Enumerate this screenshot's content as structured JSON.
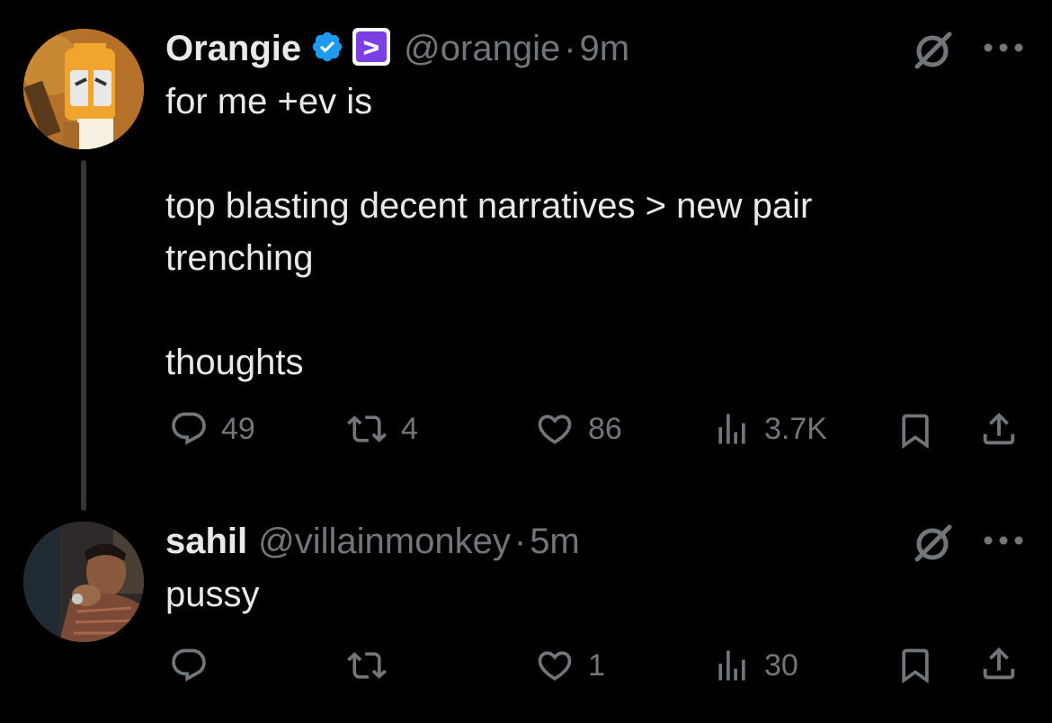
{
  "tweets": [
    {
      "name": "Orangie",
      "handle": "@orangie",
      "separator": "·",
      "time": "9m",
      "body": "for me +ev is\n\ntop blasting decent narratives > new pair\ntrenching\n\nthoughts",
      "replies": "49",
      "reposts": "4",
      "likes": "86",
      "views": "3.7K",
      "icons": {
        "verified": "verified-badge-icon",
        "affiliate": "affiliate-badge-icon",
        "grok": "grok-icon",
        "more": "more-icon"
      }
    },
    {
      "name": "sahil",
      "handle": "@villainmonkey",
      "separator": "·",
      "time": "5m",
      "body": "pussy",
      "replies": "",
      "reposts": "",
      "likes": "1",
      "views": "30",
      "icons": {
        "grok": "grok-icon",
        "more": "more-icon"
      }
    }
  ],
  "colors": {
    "background": "#000000",
    "text": "#e7e9ea",
    "muted": "#71767b",
    "verified": "#1d9bf0",
    "affiliate": "#7b3fe4"
  }
}
